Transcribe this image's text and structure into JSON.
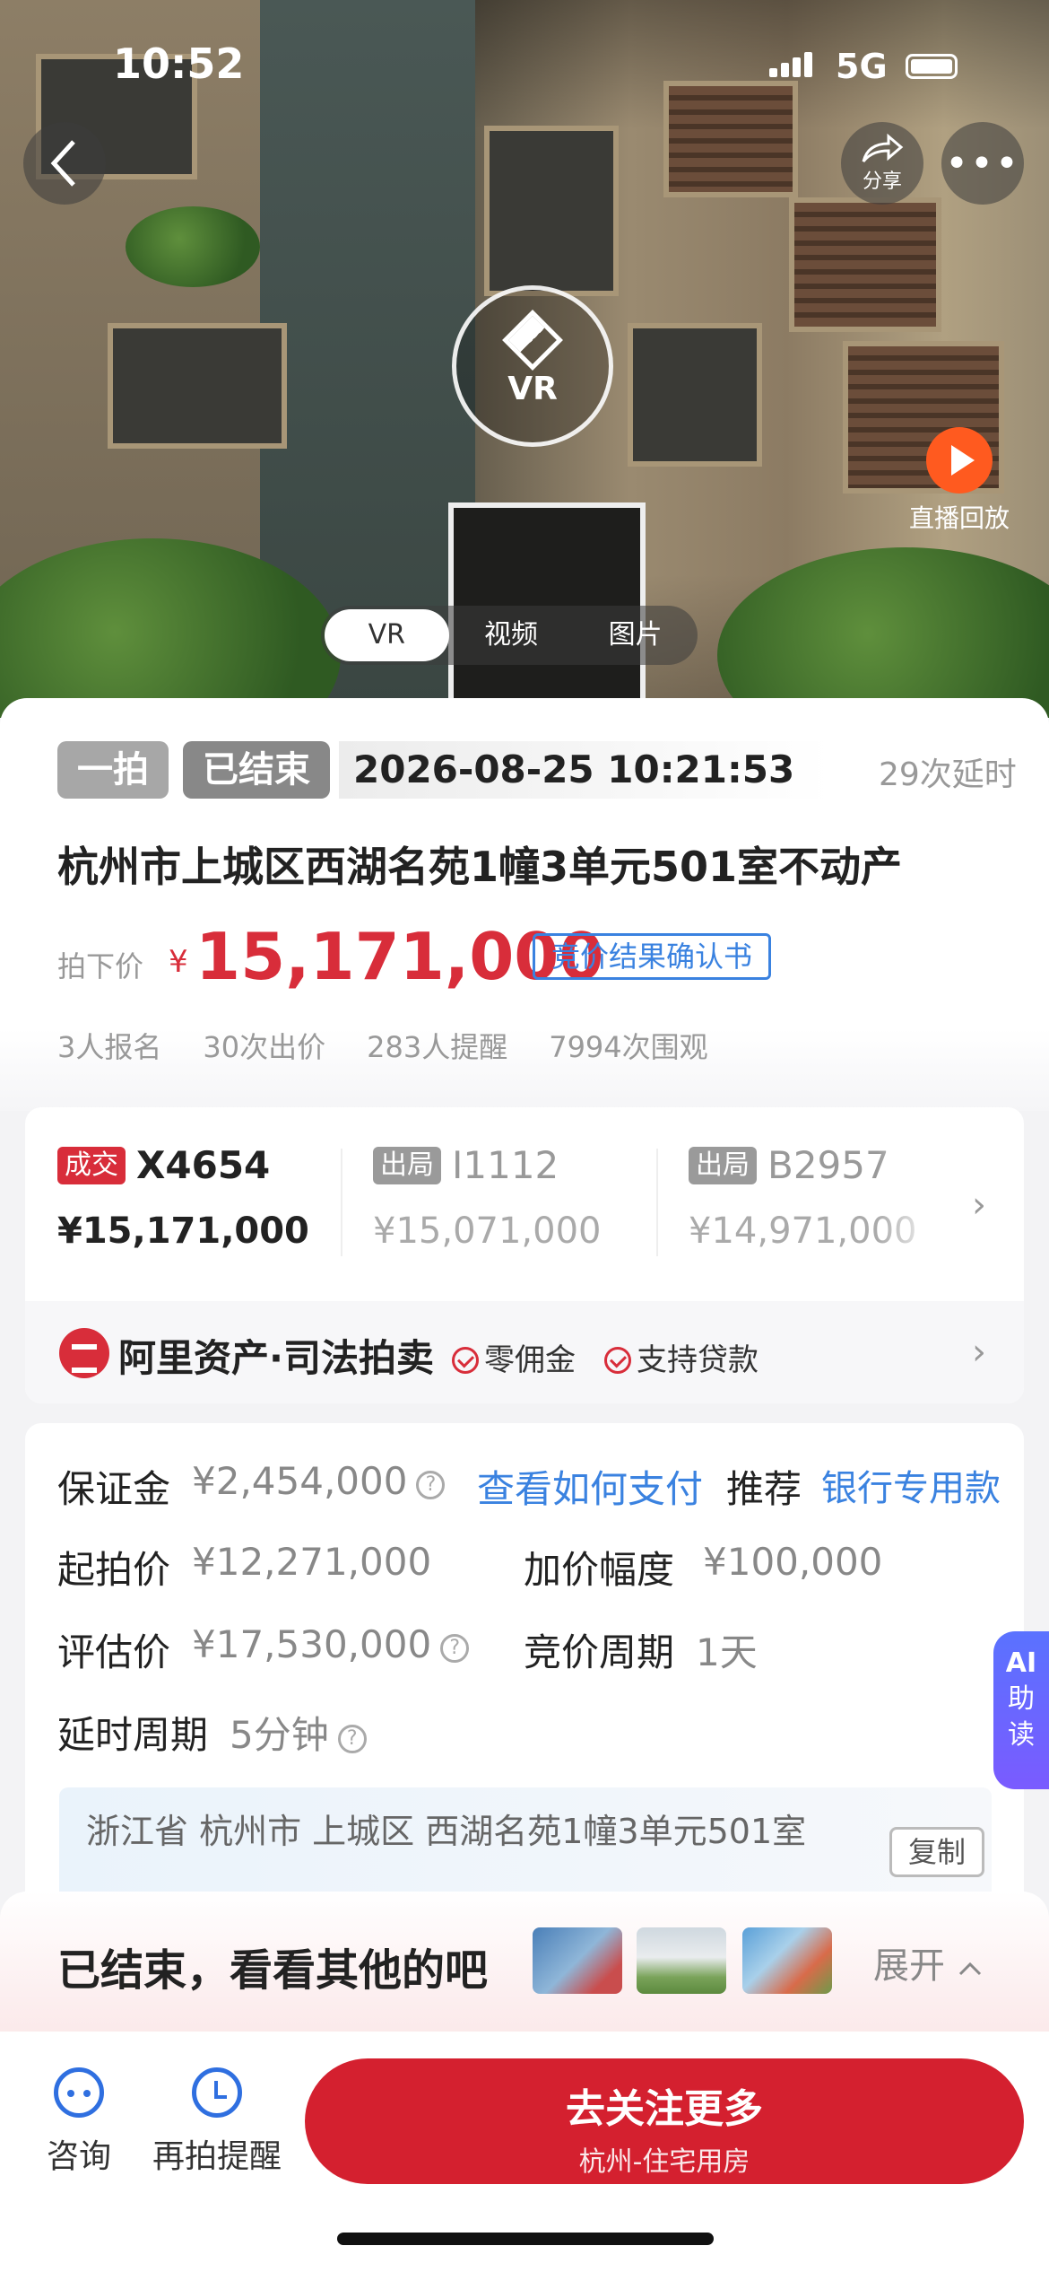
{
  "status_bar": {
    "time": "10:52",
    "network": "5G"
  },
  "hero": {
    "share_label": "分享",
    "vr_label": "VR",
    "live_replay_label": "直播回放",
    "media_tabs": [
      "VR",
      "视频",
      "图片"
    ],
    "active_tab": "VR"
  },
  "auction": {
    "round_tag": "一拍",
    "status_tag": "已结束",
    "end_time": "2026-08-25 10:21:53",
    "delay_count": "29次延时",
    "title": "杭州市上城区西湖名苑1幢3单元501室不动产",
    "price_label": "拍下价",
    "price_currency": "¥",
    "price_value": "15,171,000",
    "confirm_button": "竞价结果确认书",
    "stats": [
      "3人报名",
      "30次出价",
      "283人提醒",
      "7994次围观"
    ]
  },
  "bidders": [
    {
      "tag": "成交",
      "tag_color": "#d82d3a",
      "code": "X4654",
      "price": "¥15,171,000"
    },
    {
      "tag": "出局",
      "tag_color": "#9a9a9a",
      "code": "I1112",
      "price": "¥15,071,000"
    },
    {
      "tag": "出局",
      "tag_color": "#9a9a9a",
      "code": "B2957",
      "price": "¥14,971,000"
    }
  ],
  "platform": {
    "name": "阿里资产·司法拍卖",
    "perks": [
      "零佣金",
      "支持贷款"
    ]
  },
  "info": {
    "deposit_label": "保证金",
    "deposit_value": "¥2,454,000",
    "pay_link": "查看如何支付",
    "recommend_label": "推荐",
    "recommend_link": "银行专用款",
    "start_price_label": "起拍价",
    "start_price_value": "¥12,271,000",
    "increment_label": "加价幅度",
    "increment_value": "¥100,000",
    "appraisal_label": "评估价",
    "appraisal_value": "¥17,530,000",
    "period_label": "竞价周期",
    "period_value": "1天",
    "delay_label": "延时周期",
    "delay_value": "5分钟",
    "address": "浙江省 杭州市 上城区 西湖名苑1幢3单元501室",
    "copy_button": "复制"
  },
  "ai_tab": {
    "line1": "AI",
    "line2": "助",
    "line3": "读"
  },
  "ended_banner": {
    "text": "已结束，看看其他的吧",
    "expand": "展开"
  },
  "bottom_bar": {
    "consult_label": "咨询",
    "remind_label": "再拍提醒",
    "follow_title": "去关注更多",
    "follow_subtitle": "杭州-住宅用房"
  },
  "colors": {
    "accent_red": "#d82d3a",
    "link_blue": "#3a82e0",
    "follow_red": "#d4202f"
  }
}
